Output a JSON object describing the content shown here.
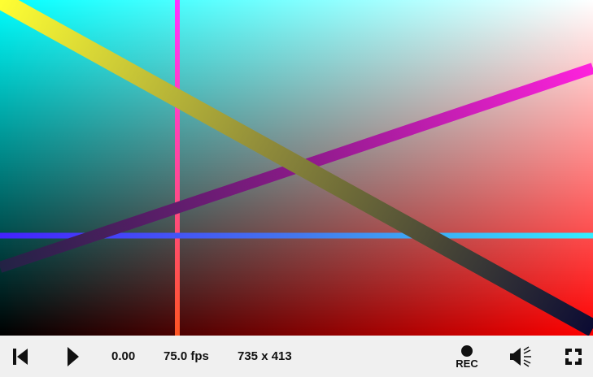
{
  "canvas": {
    "gradient_corners": {
      "top_left": "#00ffff",
      "top_right": "#ffffff",
      "bottom_left": "#000000",
      "bottom_right": "#ff0000"
    },
    "lines": [
      {
        "name": "yellow-diagonal-line",
        "from_color": "#ffff33",
        "to_color": "#0a0a33"
      },
      {
        "name": "magenta-diagonal-line",
        "from_color": "#222244",
        "to_color": "#ff22dd"
      },
      {
        "name": "vertical-line",
        "from_color": "#ff33ff",
        "to_color": "#ff5522"
      },
      {
        "name": "horizontal-line",
        "from_color": "#4422ff",
        "to_color": "#33eeff"
      }
    ]
  },
  "controls": {
    "rewind_icon": "skip-to-start-icon",
    "play_icon": "play-icon",
    "time": "0.00",
    "fps": "75.0 fps",
    "size": "735 x 413",
    "rec_label": "REC",
    "rec_icon": "record-dot-icon",
    "volume_icon": "speaker-volume-icon",
    "fullscreen_icon": "fullscreen-icon"
  }
}
